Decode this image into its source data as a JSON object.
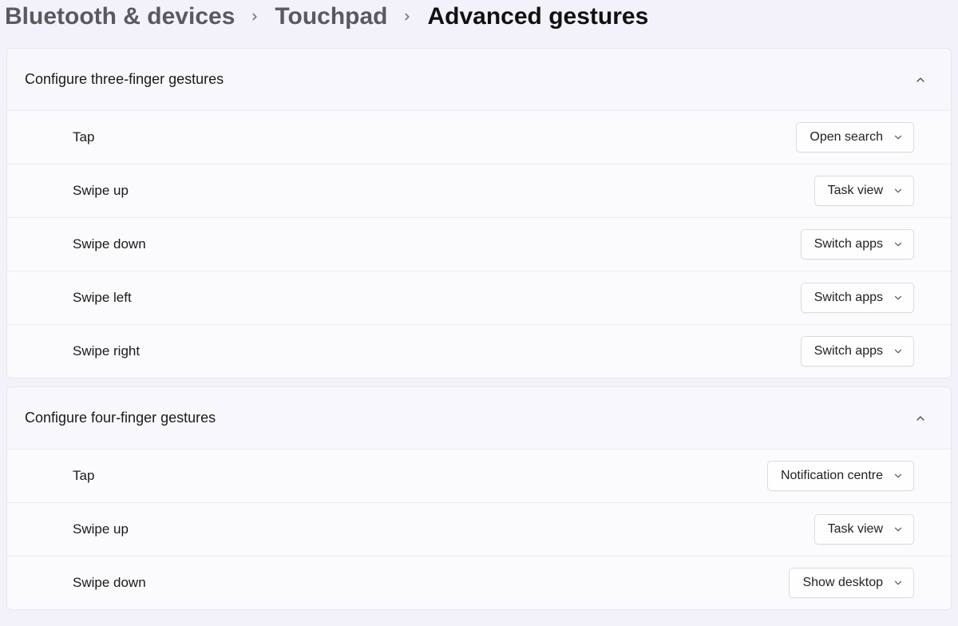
{
  "breadcrumb": {
    "items": [
      {
        "label": "Bluetooth & devices"
      },
      {
        "label": "Touchpad"
      }
    ],
    "current": "Advanced gestures"
  },
  "groups": [
    {
      "title": "Configure three-finger gestures",
      "rows": [
        {
          "label": "Tap",
          "value": "Open search"
        },
        {
          "label": "Swipe up",
          "value": "Task view"
        },
        {
          "label": "Swipe down",
          "value": "Switch apps"
        },
        {
          "label": "Swipe left",
          "value": "Switch apps"
        },
        {
          "label": "Swipe right",
          "value": "Switch apps"
        }
      ]
    },
    {
      "title": "Configure four-finger gestures",
      "rows": [
        {
          "label": "Tap",
          "value": "Notification centre"
        },
        {
          "label": "Swipe up",
          "value": "Task view"
        },
        {
          "label": "Swipe down",
          "value": "Show desktop"
        }
      ]
    }
  ]
}
